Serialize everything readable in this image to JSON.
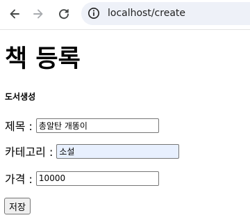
{
  "browser": {
    "url": "localhost/create",
    "icons": {
      "back": "arrow-left-icon",
      "forward": "arrow-right-icon",
      "reload": "reload-icon",
      "site_info": "info-circle-icon"
    }
  },
  "page": {
    "title": "책 등록",
    "subtitle": "도서생성"
  },
  "form": {
    "title": {
      "label": "제목 :",
      "value": "총알탄 개똥이"
    },
    "category": {
      "label": "카테고리 :",
      "value": "소설"
    },
    "price": {
      "label": "가격 :",
      "value": "10000"
    },
    "save_label": "저장"
  },
  "colors": {
    "omnibox_bg": "#eef1f8",
    "autofill_bg": "#e8f0fe",
    "icon": "#444746",
    "icon_disabled": "#a8abaf",
    "button_bg": "#efefef"
  }
}
